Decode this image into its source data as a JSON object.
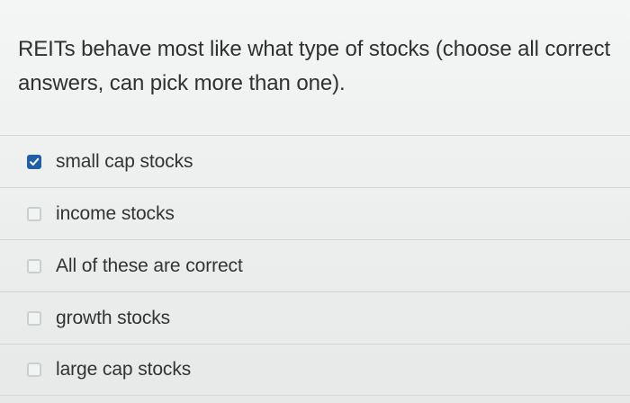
{
  "question": {
    "text": "REITs behave most like what type of stocks (choose all correct answers, can pick more than one)."
  },
  "options": [
    {
      "label": "small cap stocks",
      "checked": true
    },
    {
      "label": "income stocks",
      "checked": false
    },
    {
      "label": "All of these are correct",
      "checked": false
    },
    {
      "label": "growth stocks",
      "checked": false
    },
    {
      "label": "large cap stocks",
      "checked": false
    }
  ],
  "colors": {
    "checked_accent": "#1f5fa8",
    "checkmark": "#ffffff"
  },
  "icons": {
    "checked": "checkmark-icon"
  }
}
